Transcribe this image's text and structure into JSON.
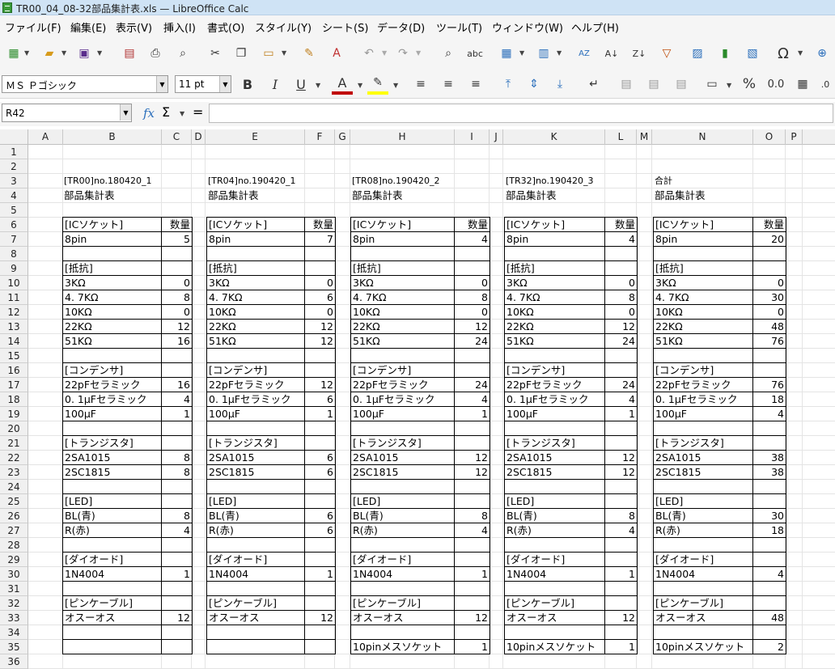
{
  "window": {
    "title": "TR00_04_08-32部品集計表.xls — LibreOffice Calc"
  },
  "menu": [
    "ファイル(F)",
    "編集(E)",
    "表示(V)",
    "挿入(I)",
    "書式(O)",
    "スタイル(Y)",
    "シート(S)",
    "データ(D)",
    "ツール(T)",
    "ウィンドウ(W)",
    "ヘルプ(H)"
  ],
  "format": {
    "font": "ＭＳ Ｐゴシック",
    "size": "11 pt"
  },
  "formula": {
    "cell_ref": "R42",
    "content": ""
  },
  "columns": [
    "A",
    "B",
    "C",
    "D",
    "E",
    "F",
    "G",
    "H",
    "I",
    "J",
    "K",
    "L",
    "M",
    "N",
    "O",
    "P"
  ],
  "rows": [
    "1",
    "2",
    "3",
    "4",
    "5",
    "6",
    "7",
    "8",
    "9",
    "10",
    "11",
    "12",
    "13",
    "14",
    "15",
    "16",
    "17",
    "18",
    "19",
    "20",
    "21",
    "22",
    "23",
    "24",
    "25",
    "26",
    "27",
    "28",
    "29",
    "30",
    "31",
    "32",
    "33",
    "34",
    "35",
    "36"
  ],
  "blocks": [
    {
      "header": "[TR00]no.180420_1",
      "title": "部品集計表",
      "v": [
        "5",
        "0",
        "8",
        "0",
        "12",
        "16",
        "16",
        "4",
        "1",
        "8",
        "8",
        "8",
        "4",
        "1",
        "12",
        ""
      ],
      "extra": ""
    },
    {
      "header": "[TR04]no.190420_1",
      "title": "部品集計表",
      "v": [
        "7",
        "0",
        "6",
        "0",
        "12",
        "12",
        "12",
        "6",
        "1",
        "6",
        "6",
        "6",
        "6",
        "1",
        "12",
        ""
      ],
      "extra": ""
    },
    {
      "header": "[TR08]no.190420_2",
      "title": "部品集計表",
      "v": [
        "4",
        "0",
        "8",
        "0",
        "12",
        "24",
        "24",
        "4",
        "1",
        "12",
        "12",
        "8",
        "4",
        "1",
        "12",
        "1"
      ],
      "extra": "10pinメスソケット"
    },
    {
      "header": "[TR32]no.190420_3",
      "title": "部品集計表",
      "v": [
        "4",
        "0",
        "8",
        "0",
        "12",
        "24",
        "24",
        "4",
        "1",
        "12",
        "12",
        "8",
        "4",
        "1",
        "12",
        "1"
      ],
      "extra": "10pinメスソケット"
    },
    {
      "header": "合計",
      "title": "部品集計表",
      "v": [
        "20",
        "0",
        "30",
        "0",
        "48",
        "76",
        "76",
        "18",
        "4",
        "38",
        "38",
        "30",
        "18",
        "4",
        "48",
        "2"
      ],
      "extra": "10pinメスソケット"
    }
  ],
  "labels": {
    "r6": "[ICソケット]",
    "qty": "数量",
    "r7": "8pin",
    "r9": "[抵抗]",
    "r10": "3KΩ",
    "r11": "4. 7KΩ",
    "r12": "10KΩ",
    "r13": "22KΩ",
    "r14": "51KΩ",
    "r16": "[コンデンサ]",
    "r17": "22pFセラミック",
    "r18": "0. 1μFセラミック",
    "r19": "100μF",
    "r21": "[トランジスタ]",
    "r22": "2SA1015",
    "r23": "2SC1815",
    "r25": "[LED]",
    "r26": "BL(青)",
    "r27": "R(赤)",
    "r29": "[ダイオード]",
    "r30": "1N4004",
    "r32": "[ピンケーブル]",
    "r33": "オスーオス"
  }
}
